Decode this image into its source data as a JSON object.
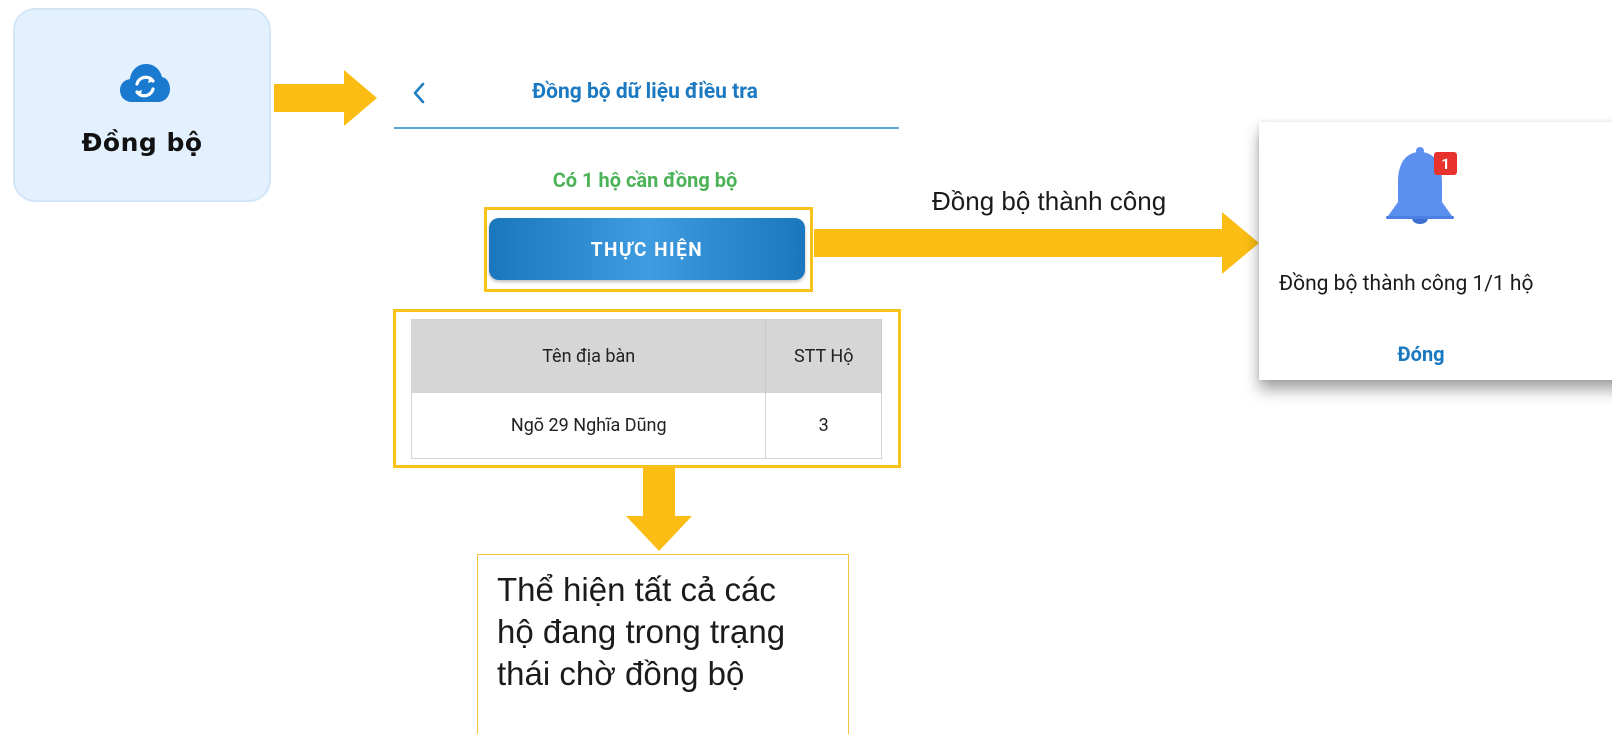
{
  "sync_tile": {
    "label": "Đồng bộ",
    "icon": "cloud-sync-icon"
  },
  "screen": {
    "title": "Đồng bộ dữ liệu điều tra",
    "back_icon": "chevron-left-icon",
    "pending_message": "Có 1 hộ cần đồng bộ",
    "execute_label": "THỰC HIỆN"
  },
  "table": {
    "headers": [
      "Tên địa bàn",
      "STT Hộ"
    ],
    "rows": [
      {
        "name": "Ngõ 29 Nghĩa Dũng",
        "stt": "3"
      }
    ]
  },
  "note": {
    "lines": [
      "Thể hiện tất cả các",
      "hộ đang trong trạng",
      "thái chờ đồng bộ"
    ]
  },
  "success_caption": "Đồng bộ thành công",
  "dialog": {
    "icon": "bell-icon",
    "badge_count": "1",
    "message": "Đồng bộ thành công 1/1 hộ",
    "close_label": "Đóng"
  },
  "colors": {
    "primary": "#1a79c0",
    "success_green": "#4cb257",
    "highlight_yellow": "#f8c21a",
    "arrow_yellow": "#fbbd14",
    "badge_red": "#e8322e",
    "tile_bg": "#e3f0fd",
    "bell": "#5b8ff0"
  }
}
